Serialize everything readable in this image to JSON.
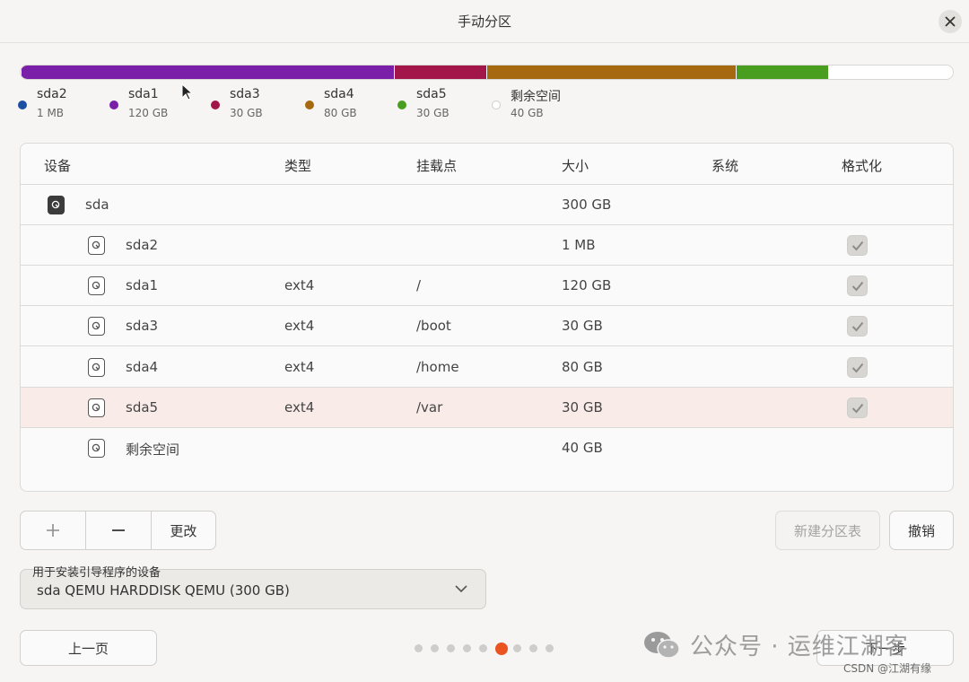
{
  "window": {
    "title": "手动分区"
  },
  "colors": {
    "sda2": "#1a4fa3",
    "sda1": "#7a1fa8",
    "sda3": "#a3164a",
    "sda4": "#a6690f",
    "sda5": "#4a9e1f",
    "free": "#ffffff",
    "accent": "#e95420"
  },
  "partition_bar": [
    {
      "name": "sda2",
      "size_gb": 0.001
    },
    {
      "name": "sda1",
      "size_gb": 120
    },
    {
      "name": "sda3",
      "size_gb": 30
    },
    {
      "name": "sda4",
      "size_gb": 80
    },
    {
      "name": "sda5",
      "size_gb": 30
    },
    {
      "name": "free",
      "size_gb": 40
    }
  ],
  "legend": [
    {
      "name": "sda2",
      "size": "1 MB"
    },
    {
      "name": "sda1",
      "size": "120 GB"
    },
    {
      "name": "sda3",
      "size": "30 GB"
    },
    {
      "name": "sda4",
      "size": "80 GB"
    },
    {
      "name": "sda5",
      "size": "30 GB"
    },
    {
      "name": "剩余空间",
      "size": "40 GB"
    }
  ],
  "table": {
    "headers": {
      "device": "设备",
      "type": "类型",
      "mount": "挂载点",
      "size": "大小",
      "system": "系统",
      "format": "格式化"
    },
    "disk": {
      "device": "sda",
      "size": "300 GB"
    },
    "rows": [
      {
        "device": "sda2",
        "type": "",
        "mount": "",
        "size": "1 MB",
        "format": true
      },
      {
        "device": "sda1",
        "type": "ext4",
        "mount": "/",
        "size": "120 GB",
        "format": true
      },
      {
        "device": "sda3",
        "type": "ext4",
        "mount": "/boot",
        "size": "30 GB",
        "format": true
      },
      {
        "device": "sda4",
        "type": "ext4",
        "mount": "/home",
        "size": "80 GB",
        "format": true
      },
      {
        "device": "sda5",
        "type": "ext4",
        "mount": "/var",
        "size": "30 GB",
        "format": true,
        "selected": true
      },
      {
        "device": "剩余空间",
        "type": "",
        "mount": "",
        "size": "40 GB",
        "format": false
      }
    ]
  },
  "actions": {
    "add": "+",
    "remove": "−",
    "change": "更改",
    "new_table": "新建分区表",
    "revert": "撤销"
  },
  "bootloader": {
    "label": "用于安装引导程序的设备",
    "value": "sda QEMU HARDDISK QEMU (300 GB)"
  },
  "nav": {
    "back": "上一页",
    "next": "下一步",
    "pages": 9,
    "current": 6
  },
  "watermark": {
    "text": "公众号 · 运维江湖客",
    "csdn": "CSDN @江湖有缘"
  }
}
